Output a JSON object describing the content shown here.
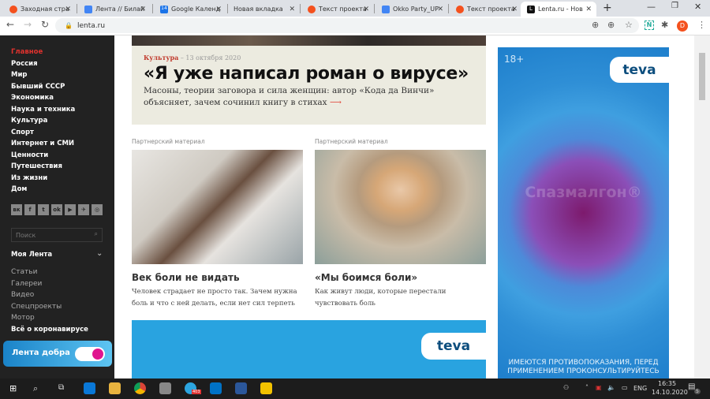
{
  "browser": {
    "tabs": [
      {
        "label": "Заходная стра",
        "color": "#f4511e"
      },
      {
        "label": "Лента // Билай",
        "color": "#4285f4"
      },
      {
        "label": "Google Календ",
        "color": "#1a73e8"
      },
      {
        "label": "Новая вкладка",
        "color": ""
      },
      {
        "label": "Текст проекта",
        "color": "#f4511e"
      },
      {
        "label": "Okko Party_UP",
        "color": "#4285f4"
      },
      {
        "label": "Текст проекта",
        "color": "#f4511e"
      },
      {
        "label": "Lenta.ru - Нов",
        "color": "#111111"
      }
    ],
    "calendar_day": "14",
    "new_tab": "+",
    "url": "lenta.ru",
    "profile_initial": "D",
    "extension_label": "N"
  },
  "sidebar": {
    "nav": [
      "Главное",
      "Россия",
      "Мир",
      "Бывший СССР",
      "Экономика",
      "Наука и техника",
      "Культура",
      "Спорт",
      "Интернет и СМИ",
      "Ценности",
      "Путешествия",
      "Из жизни",
      "Дом"
    ],
    "active_color": "#e0322e",
    "social": [
      "вк",
      "f",
      "t",
      "ok",
      "▶",
      "✈",
      "◎"
    ],
    "search_placeholder": "Поиск",
    "my_feed": "Моя Лента",
    "sub": [
      "Статьи",
      "Галереи",
      "Видео",
      "Спецпроекты",
      "Мотор"
    ],
    "corona": "Всё о коронавирусе",
    "dobra": "Лента добра"
  },
  "hero": {
    "rubric": "Культура",
    "date": " – 13 октября 2020",
    "title": "«Я уже написал роман о вирусе»",
    "lead": "Масоны, теории заговора и сила женщин: автор «Кода да Винчи» объясняет, зачем сочинил книгу в стихах",
    "arrow": "⟶"
  },
  "cards": [
    {
      "partner": "Партнерский материал",
      "title": "Век боли не видать",
      "desc": "Человек страдает не просто так. Зачем нужна боль и что с ней делать, если нет сил терпеть"
    },
    {
      "partner": "Партнерский материал",
      "title": "«Мы боимся боли»",
      "desc": "Как живут люди, которые перестали чувствовать боль"
    }
  ],
  "ad": {
    "age": "18+",
    "brand": "teva",
    "product": "Спазмалгон®",
    "warning": "ИМЕЮТСЯ ПРОТИВОПОКАЗАНИЯ, ПЕРЕД ПРИМЕНЕНИЕМ ПРОКОНСУЛЬТИРУЙТЕСЬ"
  },
  "taskbar": {
    "lang": "ENG",
    "time": "16:35",
    "date": "14.10.2020",
    "notifications": "5",
    "badge": "403"
  }
}
